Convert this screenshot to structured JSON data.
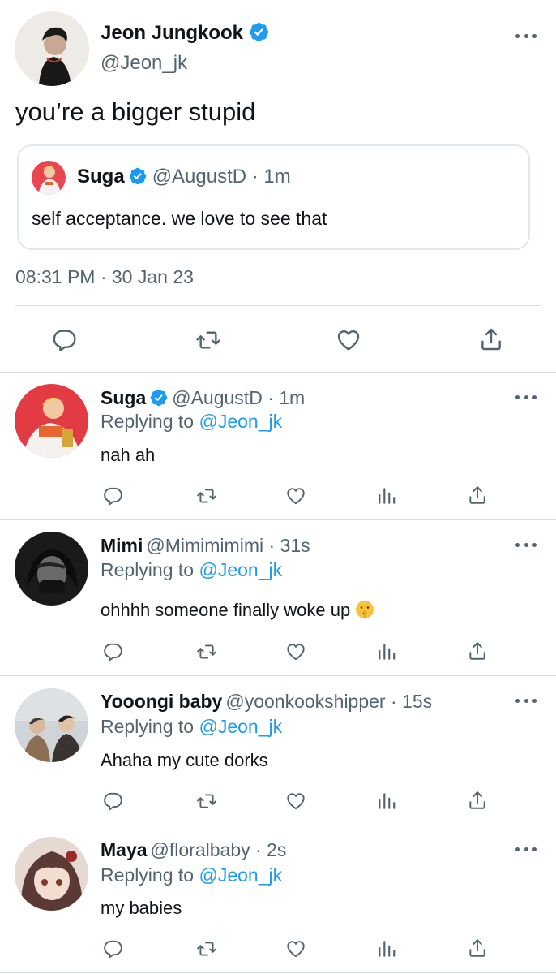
{
  "colors": {
    "text": "#0f1419",
    "secondary": "#536471",
    "accent": "#1d9bf0",
    "divider": "#d6dde3"
  },
  "main_tweet": {
    "name": "Jeon Jungkook",
    "handle": "@Jeon_jk",
    "verified": true,
    "text": "you’re a bigger stupid",
    "timestamp": "08:31 PM · 30 Jan 23",
    "quoted": {
      "name": "Suga",
      "handle": "@AugustD · 1m",
      "verified": true,
      "text": "self acceptance. we love to see that"
    },
    "actions": [
      "reply-icon",
      "retweet-icon",
      "like-icon",
      "share-icon"
    ]
  },
  "replies": [
    {
      "name": "Suga",
      "handle": "@AugustD · 1m",
      "verified": true,
      "replying_label": "Replying to",
      "replying_to": "@Jeon_jk",
      "text": "nah ah"
    },
    {
      "name": "Mimi",
      "handle": "@Mimimimimi · 31s",
      "verified": false,
      "replying_label": "Replying to",
      "replying_to": "@Jeon_jk",
      "text": "ohhhh someone finally woke up",
      "emoji": "shushing-face"
    },
    {
      "name": "Yooongi baby",
      "handle": "@yoonkookshipper · 15s",
      "verified": false,
      "replying_label": "Replying to",
      "replying_to": "@Jeon_jk",
      "text": "Ahaha my cute dorks"
    },
    {
      "name": "Maya",
      "handle": "@floralbaby · 2s",
      "verified": false,
      "replying_label": "Replying to",
      "replying_to": "@Jeon_jk",
      "text": "my babies"
    }
  ],
  "reply_actions": [
    "reply-icon",
    "retweet-icon",
    "like-icon",
    "analytics-icon",
    "share-icon"
  ]
}
